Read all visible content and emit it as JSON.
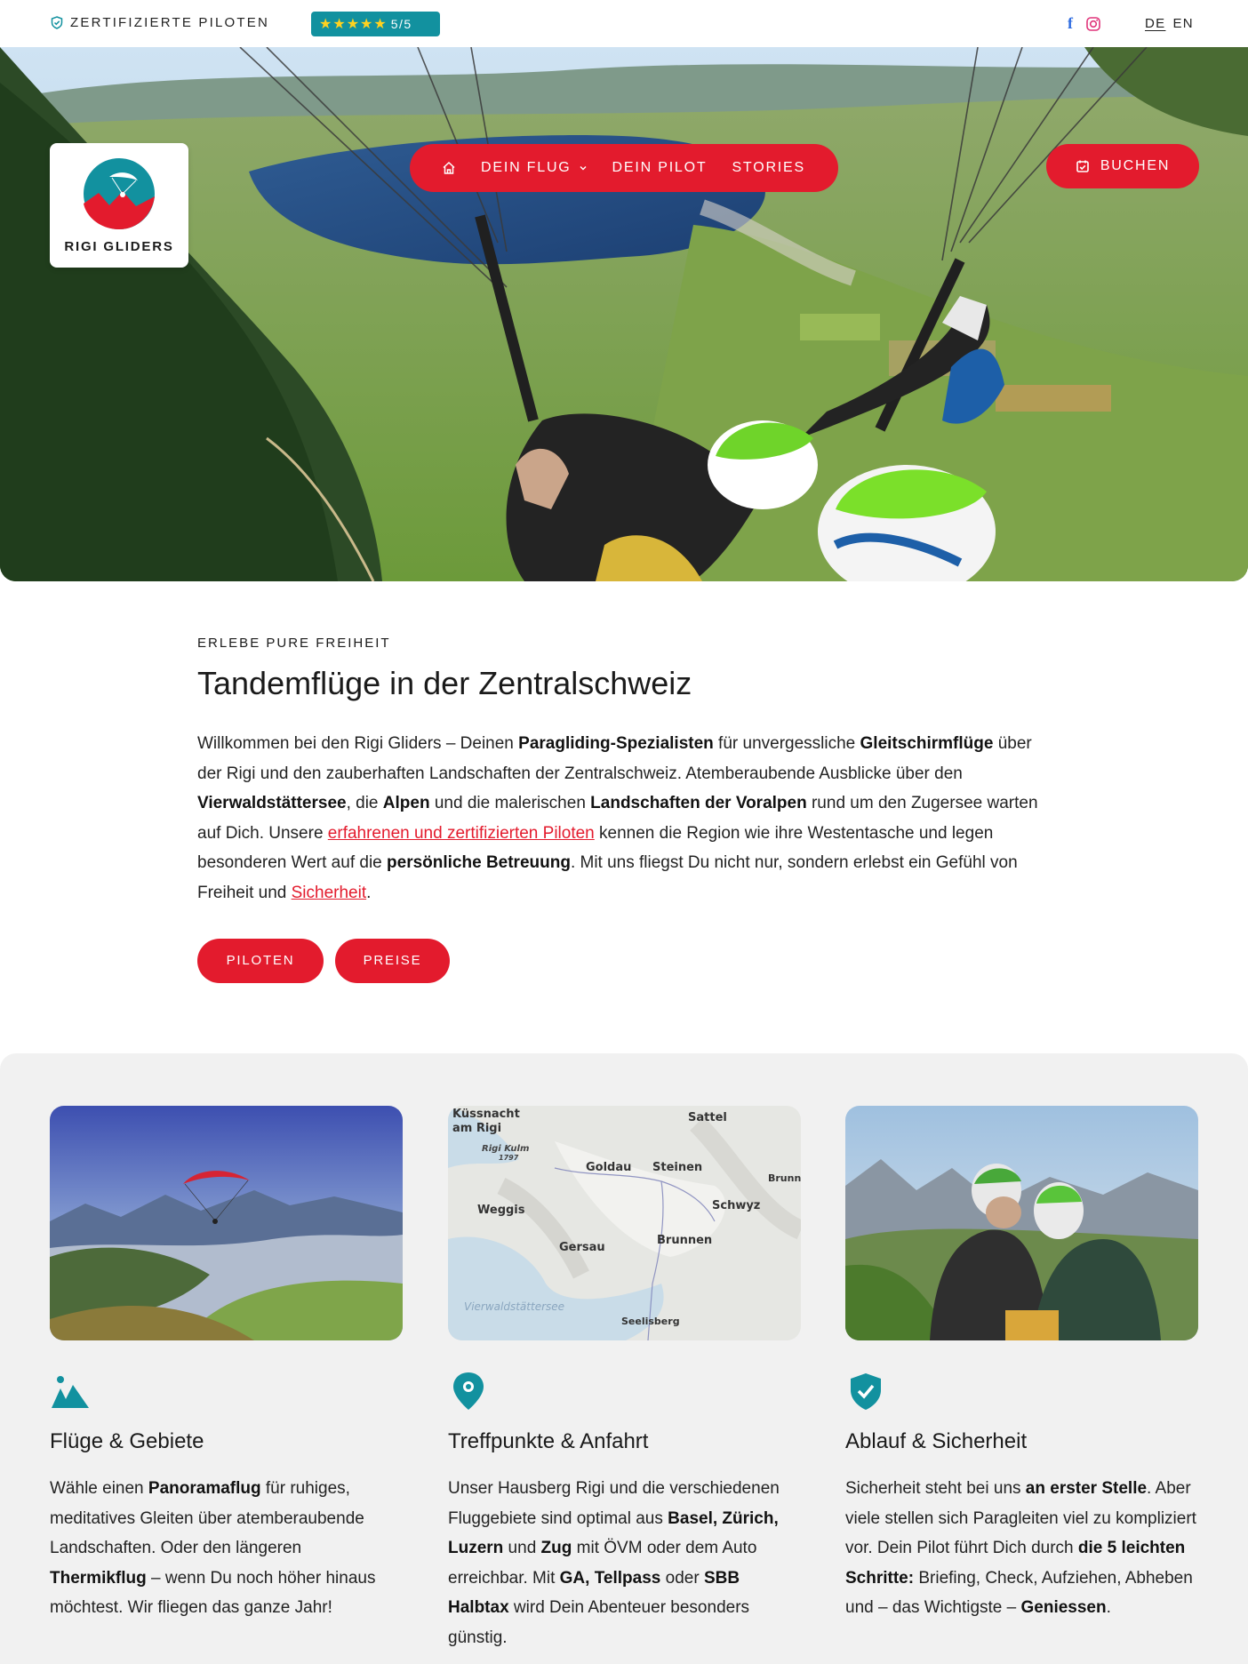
{
  "topbar": {
    "certified": "ZERTIFIZIERTE PILOTEN",
    "rating_stars": "★★★★★",
    "rating_score": "5/5",
    "lang_de": "DE",
    "lang_en": "EN",
    "social": [
      "facebook-icon",
      "instagram-icon"
    ]
  },
  "header": {
    "brand": "RIGI GLIDERS",
    "nav": {
      "flight": "DEIN FLUG",
      "pilot": "DEIN PILOT",
      "stories": "STORIES"
    },
    "book": "BUCHEN"
  },
  "intro": {
    "eyebrow": "ERLEBE PURE FREIHEIT",
    "title": "Tandemflüge in der Zentralschweiz",
    "p": [
      "Willkommen bei den Rigi Gliders – Deinen ",
      "Paragliding-Spezialisten",
      " für unvergessliche ",
      "Gleitschirmflüge",
      " über der Rigi und den zauberhaften Landschaften der Zentralschweiz. Atemberaubende Ausblicke über den ",
      "Vierwaldstättersee",
      ", die ",
      "Alpen",
      " und die malerischen ",
      "Landschaften der Voralpen",
      " rund um den Zugersee warten auf Dich. Unsere ",
      "erfahrenen und zertifizierten Piloten",
      " kennen die Region wie ihre Westentasche und legen besonderen Wert auf die ",
      "persönliche Betreuung",
      ". Mit uns fliegst Du nicht nur, sondern erlebst ein Gefühl von Freiheit und ",
      "Sicherheit",
      "."
    ],
    "btn_pilots": "PILOTEN",
    "btn_prices": "PREISE"
  },
  "map": {
    "labels": [
      "Küssnacht",
      "am Rigi",
      "Sattel",
      "Rigi Kulm",
      "1797",
      "Goldau",
      "Steinen",
      "Brunn",
      "Weggis",
      "Schwyz",
      "Gersau",
      "Brunnen",
      "Vierwaldstättersee",
      "Seelisberg"
    ]
  },
  "features": [
    {
      "icon": "mountains-icon",
      "title": "Flüge & Gebiete",
      "p": [
        "Wähle einen ",
        "Panoramaflug",
        " für ruhiges, meditatives Gleiten über atemberaubende Landschaften. Oder den längeren ",
        "Thermikflug",
        " – wenn Du noch höher hinaus möchtest. Wir fliegen das ganze Jahr!"
      ]
    },
    {
      "icon": "map-pin-icon",
      "title": "Treffpunkte & Anfahrt",
      "p": [
        "Unser Hausberg Rigi und die verschiedenen Fluggebiete sind optimal aus ",
        "Basel, Zürich, Luzern",
        " und ",
        "Zug",
        " mit ÖVM oder dem Auto erreichbar. Mit ",
        "GA, Tellpass",
        " oder ",
        "SBB Halbtax",
        " wird Dein Abenteuer besonders günstig."
      ]
    },
    {
      "icon": "shield-check-icon",
      "title": "Ablauf & Sicherheit",
      "p": [
        "Sicherheit steht bei uns ",
        "an erster Stelle",
        ". Aber viele stellen sich Paragleiten viel zu kompliziert vor. Dein Pilot führt Dich durch ",
        "die 5 leichten Schritte:",
        " Briefing, Check, Aufziehen, Abheben und – das Wichtigste – ",
        "Geniessen",
        "."
      ]
    }
  ],
  "colors": {
    "accent": "#e31b2d",
    "teal": "#12919f",
    "star": "#ffd21f",
    "section_bg": "#f1f1f1"
  }
}
